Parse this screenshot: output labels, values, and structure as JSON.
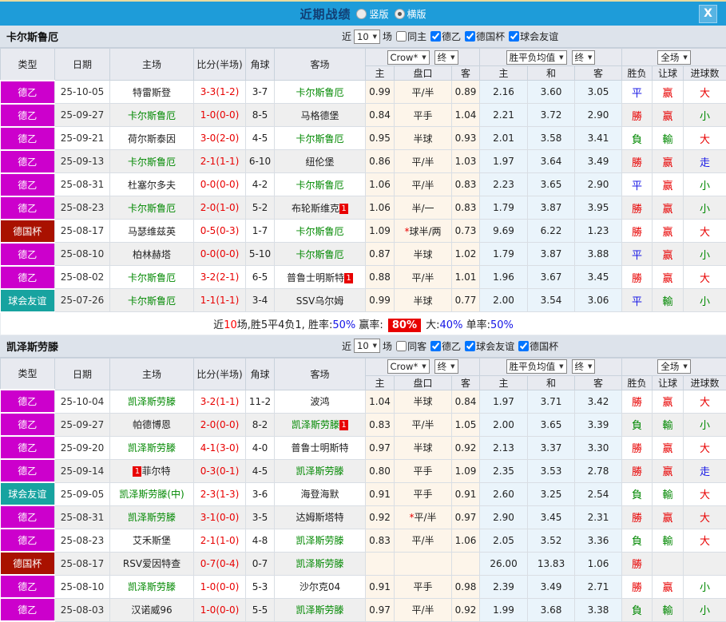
{
  "titlebar": {
    "title": "近期战绩",
    "radio_vertical": "竖版",
    "radio_horizontal": "横版",
    "selected_layout": "横版",
    "close_icon": "X"
  },
  "colors": {
    "topbar": "#1E9CD9",
    "title_text": "#123E73",
    "league": {
      "德乙": "#CC00CC",
      "德国杯": "#A91100",
      "球会友谊": "#17A3A0"
    },
    "result": {
      "勝": "#E80000",
      "負": "#008800",
      "平": "#1A1AE6",
      "赢": "#E80000",
      "輸": "#008800",
      "走": "#1A1AE6",
      "大": "#E80000",
      "小": "#008800"
    },
    "subject_team": "#008800",
    "score": "#E80000",
    "odds_bg": "#FDF5EA",
    "avg_bg": "#EAF4FB",
    "row_alt": "#EFEFEF"
  },
  "table_header": {
    "simple": [
      "类型",
      "日期",
      "主场",
      "比分(半场)",
      "角球",
      "客场"
    ],
    "groups": [
      {
        "selects": [
          "Crow*",
          "终"
        ],
        "cols": [
          "主",
          "盘口",
          "客"
        ]
      },
      {
        "selects": [
          "胜平负均值",
          "终"
        ],
        "cols": [
          "主",
          "和",
          "客"
        ]
      },
      {
        "selects": [
          "全场"
        ],
        "cols": [
          "胜负",
          "让球",
          "进球数"
        ]
      }
    ]
  },
  "sections": [
    {
      "team": "卡尔斯鲁厄",
      "near_label": "近",
      "count": "10",
      "games_label": "场",
      "filters": [
        {
          "label": "同主",
          "checked": false
        },
        {
          "label": "德乙",
          "checked": true
        },
        {
          "label": "德国杯",
          "checked": true
        },
        {
          "label": "球会友谊",
          "checked": true
        }
      ],
      "rows": [
        {
          "type": "德乙",
          "date": "25-10-05",
          "home": "特雷斯登",
          "home_green": false,
          "home_badge": "",
          "home_badge_pos": "after",
          "score": "3-3(1-2)",
          "corners": "3-7",
          "away": "卡尔斯鲁厄",
          "away_green": true,
          "away_badge": "",
          "odds": [
            "0.99",
            "平/半",
            "0.89"
          ],
          "odds_star": false,
          "avg": [
            "2.16",
            "3.60",
            "3.05"
          ],
          "results": [
            "平",
            "赢",
            "大"
          ]
        },
        {
          "type": "德乙",
          "date": "25-09-27",
          "home": "卡尔斯鲁厄",
          "home_green": true,
          "home_badge": "",
          "home_badge_pos": "after",
          "score": "1-0(0-0)",
          "corners": "8-5",
          "away": "马格德堡",
          "away_green": false,
          "away_badge": "",
          "odds": [
            "0.84",
            "平手",
            "1.04"
          ],
          "odds_star": false,
          "avg": [
            "2.21",
            "3.72",
            "2.90"
          ],
          "results": [
            "勝",
            "赢",
            "小"
          ]
        },
        {
          "type": "德乙",
          "date": "25-09-21",
          "home": "荷尔斯泰因",
          "home_green": false,
          "home_badge": "",
          "home_badge_pos": "after",
          "score": "3-0(2-0)",
          "corners": "4-5",
          "away": "卡尔斯鲁厄",
          "away_green": true,
          "away_badge": "",
          "odds": [
            "0.95",
            "半球",
            "0.93"
          ],
          "odds_star": false,
          "avg": [
            "2.01",
            "3.58",
            "3.41"
          ],
          "results": [
            "負",
            "輸",
            "大"
          ]
        },
        {
          "type": "德乙",
          "date": "25-09-13",
          "home": "卡尔斯鲁厄",
          "home_green": true,
          "home_badge": "",
          "home_badge_pos": "after",
          "score": "2-1(1-1)",
          "corners": "6-10",
          "away": "纽伦堡",
          "away_green": false,
          "away_badge": "",
          "odds": [
            "0.86",
            "平/半",
            "1.03"
          ],
          "odds_star": false,
          "avg": [
            "1.97",
            "3.64",
            "3.49"
          ],
          "results": [
            "勝",
            "赢",
            "走"
          ]
        },
        {
          "type": "德乙",
          "date": "25-08-31",
          "home": "杜塞尔多夫",
          "home_green": false,
          "home_badge": "",
          "home_badge_pos": "after",
          "score": "0-0(0-0)",
          "corners": "4-2",
          "away": "卡尔斯鲁厄",
          "away_green": true,
          "away_badge": "",
          "odds": [
            "1.06",
            "平/半",
            "0.83"
          ],
          "odds_star": false,
          "avg": [
            "2.23",
            "3.65",
            "2.90"
          ],
          "results": [
            "平",
            "赢",
            "小"
          ]
        },
        {
          "type": "德乙",
          "date": "25-08-23",
          "home": "卡尔斯鲁厄",
          "home_green": true,
          "home_badge": "",
          "home_badge_pos": "after",
          "score": "2-0(1-0)",
          "corners": "5-2",
          "away": "布轮斯维克",
          "away_green": false,
          "away_badge": "1",
          "odds": [
            "1.06",
            "半/一",
            "0.83"
          ],
          "odds_star": false,
          "avg": [
            "1.79",
            "3.87",
            "3.95"
          ],
          "results": [
            "勝",
            "赢",
            "小"
          ]
        },
        {
          "type": "德国杯",
          "date": "25-08-17",
          "home": "马瑟维兹英",
          "home_green": false,
          "home_badge": "",
          "home_badge_pos": "after",
          "score": "0-5(0-3)",
          "corners": "1-7",
          "away": "卡尔斯鲁厄",
          "away_green": true,
          "away_badge": "",
          "odds": [
            "1.09",
            "球半/两",
            "0.73"
          ],
          "odds_star": true,
          "avg": [
            "9.69",
            "6.22",
            "1.23"
          ],
          "results": [
            "勝",
            "赢",
            "大"
          ]
        },
        {
          "type": "德乙",
          "date": "25-08-10",
          "home": "柏林赫塔",
          "home_green": false,
          "home_badge": "",
          "home_badge_pos": "after",
          "score": "0-0(0-0)",
          "corners": "5-10",
          "away": "卡尔斯鲁厄",
          "away_green": true,
          "away_badge": "",
          "odds": [
            "0.87",
            "半球",
            "1.02"
          ],
          "odds_star": false,
          "avg": [
            "1.79",
            "3.87",
            "3.88"
          ],
          "results": [
            "平",
            "赢",
            "小"
          ]
        },
        {
          "type": "德乙",
          "date": "25-08-02",
          "home": "卡尔斯鲁厄",
          "home_green": true,
          "home_badge": "",
          "home_badge_pos": "after",
          "score": "3-2(2-1)",
          "corners": "6-5",
          "away": "普鲁士明斯特",
          "away_green": false,
          "away_badge": "1",
          "odds": [
            "0.88",
            "平/半",
            "1.01"
          ],
          "odds_star": false,
          "avg": [
            "1.96",
            "3.67",
            "3.45"
          ],
          "results": [
            "勝",
            "赢",
            "大"
          ]
        },
        {
          "type": "球会友谊",
          "date": "25-07-26",
          "home": "卡尔斯鲁厄",
          "home_green": true,
          "home_badge": "",
          "home_badge_pos": "after",
          "score": "1-1(1-1)",
          "corners": "3-4",
          "away": "SSV乌尔姆",
          "away_green": false,
          "away_badge": "",
          "odds": [
            "0.99",
            "半球",
            "0.77"
          ],
          "odds_star": false,
          "avg": [
            "2.00",
            "3.54",
            "3.06"
          ],
          "results": [
            "平",
            "輸",
            "小"
          ]
        }
      ],
      "summary": [
        {
          "text": "近",
          "style": "plain"
        },
        {
          "text": "10",
          "style": "red"
        },
        {
          "text": "场,胜5平4负1, 胜率:",
          "style": "plain"
        },
        {
          "text": "50%",
          "style": "blue"
        },
        {
          "text": " 赢率: ",
          "style": "plain"
        },
        {
          "text": "80%",
          "style": "badge"
        },
        {
          "text": " 大:",
          "style": "plain"
        },
        {
          "text": "40%",
          "style": "blue"
        },
        {
          "text": " 单率:",
          "style": "plain"
        },
        {
          "text": "50%",
          "style": "blue"
        }
      ]
    },
    {
      "team": "凯泽斯劳滕",
      "near_label": "近",
      "count": "10",
      "games_label": "场",
      "filters": [
        {
          "label": "同客",
          "checked": false
        },
        {
          "label": "德乙",
          "checked": true
        },
        {
          "label": "球会友谊",
          "checked": true
        },
        {
          "label": "德国杯",
          "checked": true
        }
      ],
      "rows": [
        {
          "type": "德乙",
          "date": "25-10-04",
          "home": "凯泽斯劳滕",
          "home_green": true,
          "home_badge": "",
          "home_badge_pos": "after",
          "score": "3-2(1-1)",
          "corners": "11-2",
          "away": "波鸿",
          "away_green": false,
          "away_badge": "",
          "odds": [
            "1.04",
            "半球",
            "0.84"
          ],
          "odds_star": false,
          "avg": [
            "1.97",
            "3.71",
            "3.42"
          ],
          "results": [
            "勝",
            "赢",
            "大"
          ]
        },
        {
          "type": "德乙",
          "date": "25-09-27",
          "home": "帕德博恩",
          "home_green": false,
          "home_badge": "",
          "home_badge_pos": "after",
          "score": "2-0(0-0)",
          "corners": "8-2",
          "away": "凯泽斯劳滕",
          "away_green": true,
          "away_badge": "1",
          "odds": [
            "0.83",
            "平/半",
            "1.05"
          ],
          "odds_star": false,
          "avg": [
            "2.00",
            "3.65",
            "3.39"
          ],
          "results": [
            "負",
            "輸",
            "小"
          ]
        },
        {
          "type": "德乙",
          "date": "25-09-20",
          "home": "凯泽斯劳滕",
          "home_green": true,
          "home_badge": "",
          "home_badge_pos": "after",
          "score": "4-1(3-0)",
          "corners": "4-0",
          "away": "普鲁士明斯特",
          "away_green": false,
          "away_badge": "",
          "odds": [
            "0.97",
            "半球",
            "0.92"
          ],
          "odds_star": false,
          "avg": [
            "2.13",
            "3.37",
            "3.30"
          ],
          "results": [
            "勝",
            "赢",
            "大"
          ]
        },
        {
          "type": "德乙",
          "date": "25-09-14",
          "home": "菲尔特",
          "home_green": false,
          "home_badge": "1",
          "home_badge_pos": "before",
          "score": "0-3(0-1)",
          "corners": "4-5",
          "away": "凯泽斯劳滕",
          "away_green": true,
          "away_badge": "",
          "odds": [
            "0.80",
            "平手",
            "1.09"
          ],
          "odds_star": false,
          "avg": [
            "2.35",
            "3.53",
            "2.78"
          ],
          "results": [
            "勝",
            "赢",
            "走"
          ]
        },
        {
          "type": "球会友谊",
          "date": "25-09-05",
          "home": "凯泽斯劳滕(中)",
          "home_green": true,
          "home_badge": "",
          "home_badge_pos": "after",
          "score": "2-3(1-3)",
          "corners": "3-6",
          "away": "海登海默",
          "away_green": false,
          "away_badge": "",
          "odds": [
            "0.91",
            "平手",
            "0.91"
          ],
          "odds_star": false,
          "avg": [
            "2.60",
            "3.25",
            "2.54"
          ],
          "results": [
            "負",
            "輸",
            "大"
          ]
        },
        {
          "type": "德乙",
          "date": "25-08-31",
          "home": "凯泽斯劳滕",
          "home_green": true,
          "home_badge": "",
          "home_badge_pos": "after",
          "score": "3-1(0-0)",
          "corners": "3-5",
          "away": "达姆斯塔特",
          "away_green": false,
          "away_badge": "",
          "odds": [
            "0.92",
            "平/半",
            "0.97"
          ],
          "odds_star": true,
          "avg": [
            "2.90",
            "3.45",
            "2.31"
          ],
          "results": [
            "勝",
            "赢",
            "大"
          ]
        },
        {
          "type": "德乙",
          "date": "25-08-23",
          "home": "艾禾斯堡",
          "home_green": false,
          "home_badge": "",
          "home_badge_pos": "after",
          "score": "2-1(1-0)",
          "corners": "4-8",
          "away": "凯泽斯劳滕",
          "away_green": true,
          "away_badge": "",
          "odds": [
            "0.83",
            "平/半",
            "1.06"
          ],
          "odds_star": false,
          "avg": [
            "2.05",
            "3.52",
            "3.36"
          ],
          "results": [
            "負",
            "輸",
            "大"
          ]
        },
        {
          "type": "德国杯",
          "date": "25-08-17",
          "home": "RSV爱因特查",
          "home_green": false,
          "home_badge": "",
          "home_badge_pos": "after",
          "score": "0-7(0-4)",
          "corners": "0-7",
          "away": "凯泽斯劳滕",
          "away_green": true,
          "away_badge": "",
          "odds": [
            "",
            "",
            ""
          ],
          "odds_star": false,
          "avg": [
            "26.00",
            "13.83",
            "1.06"
          ],
          "results": [
            "勝",
            "",
            ""
          ]
        },
        {
          "type": "德乙",
          "date": "25-08-10",
          "home": "凯泽斯劳滕",
          "home_green": true,
          "home_badge": "",
          "home_badge_pos": "after",
          "score": "1-0(0-0)",
          "corners": "5-3",
          "away": "沙尔克04",
          "away_green": false,
          "away_badge": "",
          "odds": [
            "0.91",
            "平手",
            "0.98"
          ],
          "odds_star": false,
          "avg": [
            "2.39",
            "3.49",
            "2.71"
          ],
          "results": [
            "勝",
            "赢",
            "小"
          ]
        },
        {
          "type": "德乙",
          "date": "25-08-03",
          "home": "汉诺威96",
          "home_green": false,
          "home_badge": "",
          "home_badge_pos": "after",
          "score": "1-0(0-0)",
          "corners": "5-5",
          "away": "凯泽斯劳滕",
          "away_green": true,
          "away_badge": "",
          "odds": [
            "0.97",
            "平/半",
            "0.92"
          ],
          "odds_star": false,
          "avg": [
            "1.99",
            "3.68",
            "3.38"
          ],
          "results": [
            "負",
            "輸",
            "小"
          ]
        }
      ],
      "summary": null
    }
  ]
}
